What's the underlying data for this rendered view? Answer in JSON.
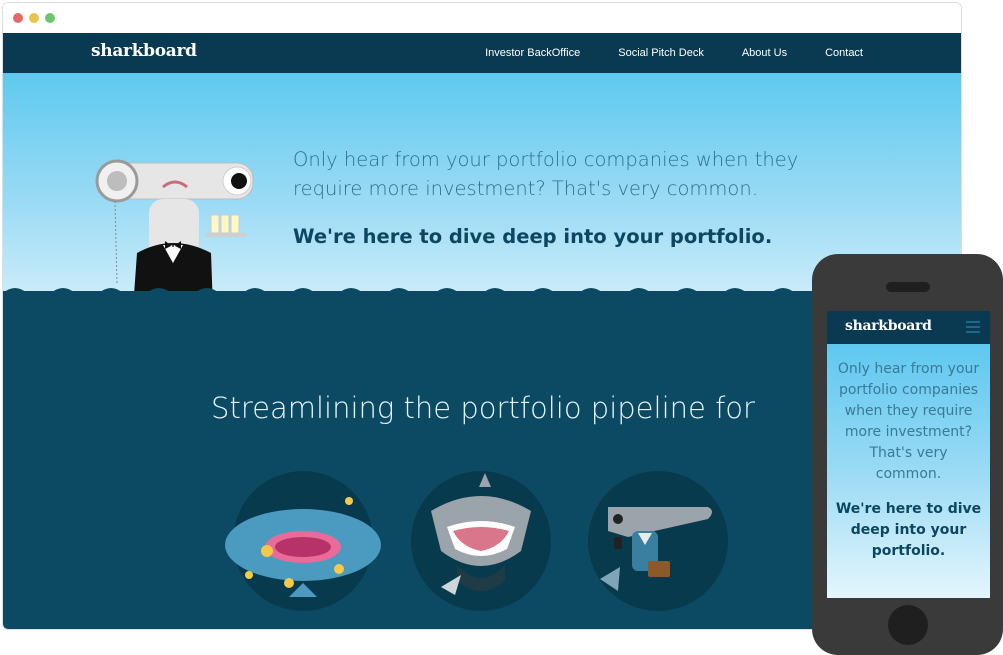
{
  "site": {
    "logo": "sharkboard",
    "nav": [
      {
        "label": "Investor BackOffice"
      },
      {
        "label": "Social Pitch Deck"
      },
      {
        "label": "About Us"
      },
      {
        "label": "Contact"
      }
    ]
  },
  "hero": {
    "lead": "Only hear from your portfolio companies when they require more investment? That's very common.",
    "tagline": "We're here to dive deep into your portfolio."
  },
  "section": {
    "heading": "Streamlining the portfolio pipeline for"
  },
  "mobile": {
    "logo": "sharkboard",
    "lead": "Only hear from your portfolio companies when they require more investment? That's very common.",
    "tagline": "We're here to dive deep into your portfolio."
  },
  "colors": {
    "nav_bg": "#0a3a52",
    "sea": "#0c4a63",
    "sky_top": "#5ec9ef",
    "accent_text": "#0c4660"
  },
  "icons": {
    "menu": "hamburger-icon",
    "mascot": "hammerhead-shark-butler",
    "audience_1": "whale-shark-with-fish",
    "audience_2": "great-white-shark",
    "audience_3": "hammerhead-shark-with-briefcase"
  }
}
